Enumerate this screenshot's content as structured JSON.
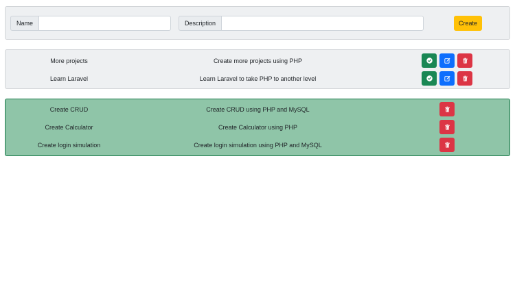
{
  "form": {
    "name_label": "Name",
    "name_value": "",
    "description_label": "Description",
    "description_value": "",
    "create_label": "Create"
  },
  "pending": [
    {
      "name": "More projects",
      "description": "Create more projects using PHP"
    },
    {
      "name": "Learn Laravel",
      "description": "Learn Laravel to take PHP to another level"
    }
  ],
  "completed": [
    {
      "name": "Create CRUD",
      "description": "Create CRUD using PHP and MySQL"
    },
    {
      "name": "Create Calculator",
      "description": "Create Calculator using PHP"
    },
    {
      "name": "Create login simulation",
      "description": "Create login simulation using PHP and MySQL"
    }
  ],
  "icons": {
    "complete": "check-circle-icon",
    "edit": "edit-icon",
    "delete": "trash-icon"
  },
  "colors": {
    "create_button": "#ffc107",
    "complete_button": "#198754",
    "edit_button": "#0d6efd",
    "delete_button": "#dc3545",
    "completed_background": "#8fc5a8"
  }
}
